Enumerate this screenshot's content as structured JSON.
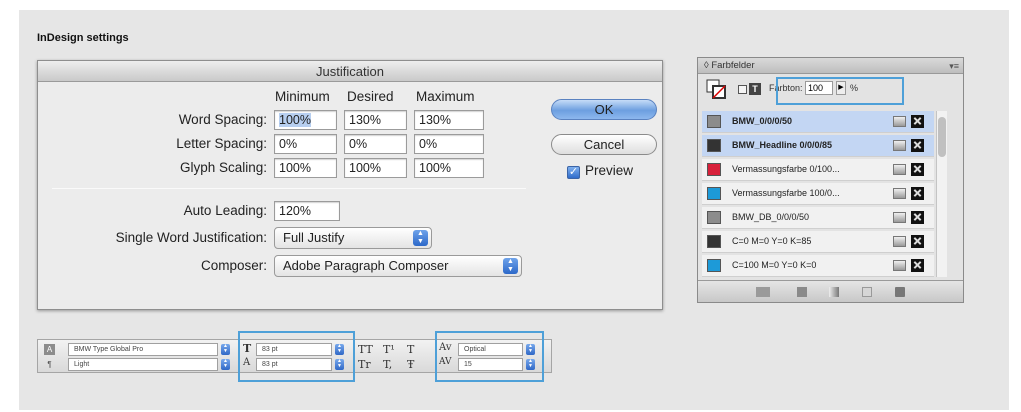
{
  "page": {
    "title": "InDesign settings"
  },
  "justification": {
    "title": "Justification",
    "columns": [
      "Minimum",
      "Desired",
      "Maximum"
    ],
    "rows": [
      {
        "label": "Word Spacing:",
        "values": [
          "100%",
          "130%",
          "130%"
        ]
      },
      {
        "label": "Letter Spacing:",
        "values": [
          "0%",
          "0%",
          "0%"
        ]
      },
      {
        "label": "Glyph Scaling:",
        "values": [
          "100%",
          "100%",
          "100%"
        ]
      }
    ],
    "auto_leading": {
      "label": "Auto Leading:",
      "value": "120%"
    },
    "single_word": {
      "label": "Single Word Justification:",
      "value": "Full Justify"
    },
    "composer": {
      "label": "Composer:",
      "value": "Adobe Paragraph Composer"
    },
    "ok_label": "OK",
    "cancel_label": "Cancel",
    "preview_label": "Preview",
    "preview_checked": true
  },
  "swatches": {
    "title": "◊ Farbfelder",
    "tint_label": "Farbton:",
    "tint_value": "100",
    "tint_unit": "%",
    "items": [
      {
        "name": "BMW_0/0/0/50",
        "color": "#8c8c8c",
        "bold": true,
        "selected": true
      },
      {
        "name": "BMW_Headline 0/0/0/85",
        "color": "#333333",
        "bold": true,
        "selected": true
      },
      {
        "name": "Vermassungsfarbe 0/100...",
        "color": "#d8203a",
        "bold": false,
        "selected": false
      },
      {
        "name": "Vermassungsfarbe 100/0...",
        "color": "#1d9ad8",
        "bold": false,
        "selected": false
      },
      {
        "name": "BMW_DB_0/0/0/50",
        "color": "#8c8c8c",
        "bold": false,
        "selected": false
      },
      {
        "name": "C=0 M=0 Y=0 K=85",
        "color": "#333333",
        "bold": false,
        "selected": false
      },
      {
        "name": "C=100 M=0 Y=0 K=0",
        "color": "#1d9ad8",
        "bold": false,
        "selected": false
      }
    ]
  },
  "control_bar": {
    "font_family": "BMW Type Global Pro",
    "font_style": "Light",
    "font_size": "83 pt",
    "leading": "83 pt",
    "kerning": "Optical",
    "tracking": "15"
  },
  "colors": {
    "highlight": "#4ea0d8",
    "background": "#e6e6e6"
  }
}
